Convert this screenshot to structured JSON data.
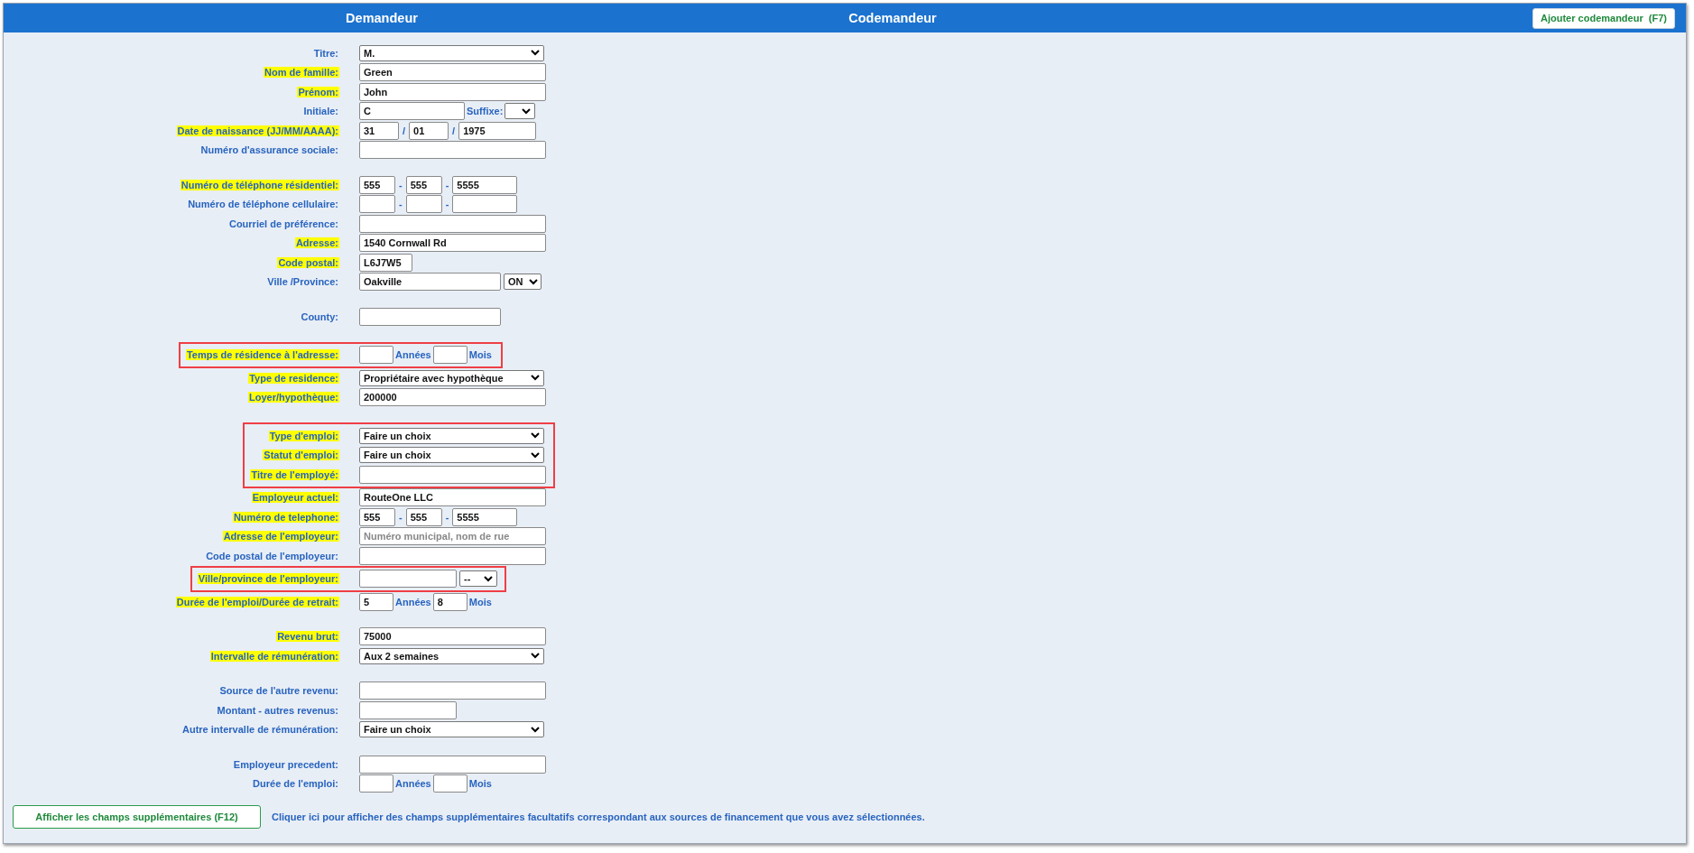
{
  "header": {
    "applicant": "Demandeur",
    "coapplicant": "Codemandeur",
    "add_button": "Ajouter codemandeur  (F7)"
  },
  "sections": [
    {
      "rows": [
        {
          "label": "Titre:",
          "required": false,
          "callout": false,
          "kind": "select",
          "value": "M."
        },
        {
          "label": "Nom de famille:",
          "required": true,
          "callout": false,
          "kind": "text",
          "value": "Green"
        },
        {
          "label": "Prénom:",
          "required": true,
          "callout": false,
          "kind": "text",
          "value": "John"
        },
        {
          "label": "Initiale:",
          "required": false,
          "callout": false,
          "kind": "initial",
          "value": "C",
          "suffix_label": "Suffixe:"
        },
        {
          "label": "Date de naissance (JJ/MM/AAAA):",
          "required": true,
          "callout": false,
          "kind": "date",
          "parts": [
            "31",
            "01",
            "1975"
          ],
          "separators": [
            "/",
            "/"
          ]
        },
        {
          "label": "Numéro d'assurance sociale:",
          "required": false,
          "callout": false,
          "kind": "text"
        }
      ]
    },
    {
      "rows": [
        {
          "label": "Numéro de téléphone résidentiel:",
          "required": true,
          "callout": false,
          "kind": "phone",
          "parts": [
            "555",
            "555",
            "5555"
          ],
          "separators": [
            "-",
            "-"
          ]
        },
        {
          "label": "Numéro de téléphone cellulaire:",
          "required": false,
          "callout": false,
          "kind": "phone",
          "separators": [
            "-",
            "-"
          ]
        },
        {
          "label": "Courriel de préférence:",
          "required": false,
          "callout": false,
          "kind": "text"
        },
        {
          "label": "Adresse:",
          "required": true,
          "callout": false,
          "kind": "text",
          "value": "1540 Cornwall Rd"
        },
        {
          "label": "Code postal:",
          "required": true,
          "callout": false,
          "kind": "short-text",
          "value": "L6J7W5"
        },
        {
          "label": "Ville /Province:",
          "required": false,
          "callout": false,
          "kind": "city",
          "value": "Oakville",
          "province": "ON"
        }
      ]
    },
    {
      "rows": [
        {
          "label": "County:",
          "required": false,
          "callout": false,
          "kind": "mid-text"
        }
      ]
    },
    {
      "rows": [
        {
          "label": "Temps de résidence à l'adresse:",
          "required": true,
          "callout": true,
          "kind": "duration",
          "years_label": "Années",
          "months_label": "Mois"
        },
        {
          "label": "Type de residence:",
          "required": true,
          "callout": false,
          "kind": "select",
          "value": "Propriétaire avec hypothèque"
        },
        {
          "label": "Loyer/hypothèque:",
          "required": true,
          "callout": false,
          "kind": "text",
          "value": "200000"
        }
      ]
    },
    {
      "rows": [
        {
          "label": "Type d'emploi:",
          "required": true,
          "callout": true,
          "kind": "select",
          "value": "Faire un choix"
        },
        {
          "label": "Statut d'emploi:",
          "required": true,
          "callout": true,
          "kind": "select",
          "value": "Faire un choix"
        },
        {
          "label": "Titre de l'employé:",
          "required": true,
          "callout": true,
          "kind": "text"
        },
        {
          "label": "Employeur actuel:",
          "required": true,
          "callout": false,
          "kind": "text",
          "value": "RouteOne LLC"
        },
        {
          "label": "Numéro de telephone:",
          "required": true,
          "callout": false,
          "kind": "phone",
          "parts": [
            "555",
            "555",
            "5555"
          ],
          "separators": [
            "-",
            "-"
          ]
        },
        {
          "label": "Adresse de l'employeur:",
          "required": true,
          "callout": false,
          "kind": "text",
          "placeholder": "Numéro municipal, nom de rue"
        },
        {
          "label": "Code postal de l'employeur:",
          "required": false,
          "callout": false,
          "kind": "text"
        },
        {
          "label": "Ville/province de l'employeur:",
          "required": true,
          "callout": true,
          "kind": "city",
          "province": "--"
        },
        {
          "label": "Durée de l'emploi/Durée de retrait:",
          "required": true,
          "callout": false,
          "kind": "duration",
          "years": "5",
          "months": "8",
          "years_label": "Années",
          "months_label": "Mois"
        }
      ]
    },
    {
      "rows": [
        {
          "label": "Revenu brut:",
          "required": true,
          "callout": false,
          "kind": "text",
          "value": "75000"
        },
        {
          "label": "Intervalle de rémunération:",
          "required": true,
          "callout": false,
          "kind": "select",
          "value": "Aux 2 semaines"
        }
      ]
    },
    {
      "rows": [
        {
          "label": "Source de l'autre revenu:",
          "required": false,
          "callout": false,
          "kind": "text"
        },
        {
          "label": "Montant - autres revenus:",
          "required": false,
          "callout": false,
          "kind": "half-text"
        },
        {
          "label": "Autre intervalle de rémunération:",
          "required": false,
          "callout": false,
          "kind": "select",
          "value": "Faire un choix"
        }
      ]
    },
    {
      "rows": [
        {
          "label": "Employeur precedent:",
          "required": false,
          "callout": false,
          "kind": "text"
        },
        {
          "label": "Durée de l'emploi:",
          "required": false,
          "callout": false,
          "kind": "duration",
          "years_label": "Années",
          "months_label": "Mois"
        }
      ]
    }
  ],
  "footer": {
    "button": "Afficher les champs supplémentaires (F12)",
    "hint": "Cliquer ici pour afficher des champs supplémentaires facultatifs correspondant aux sources de financement que vous avez sélectionnées."
  }
}
